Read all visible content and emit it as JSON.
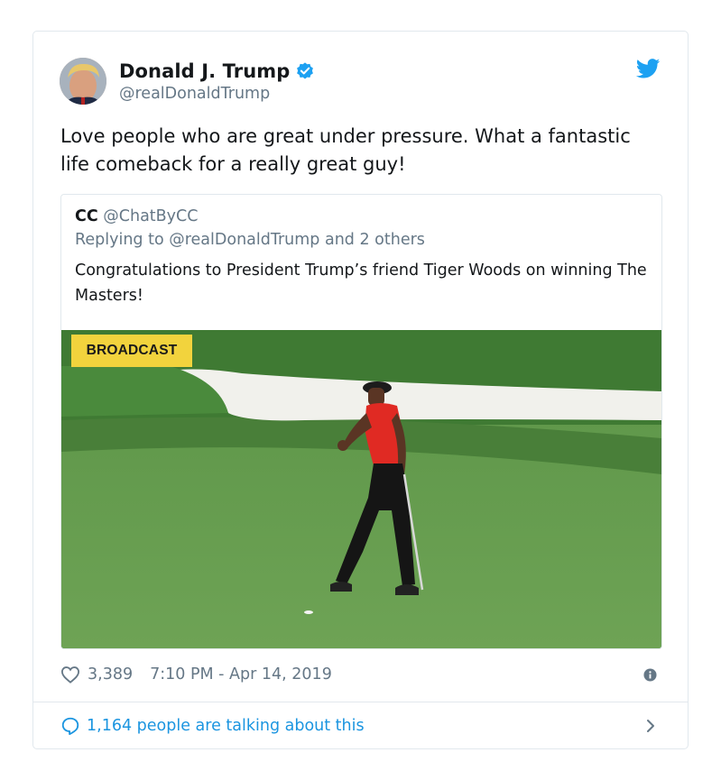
{
  "tweet": {
    "author": {
      "display_name": "Donald J. Trump",
      "handle": "@realDonaldTrump",
      "verified": true,
      "avatar_icon": "profile-photo"
    },
    "text": "Love people who are great under pressure. What a fantastic life comeback for a really great guy!",
    "brand_icon": "twitter-bird-icon",
    "brand_color": "#1da1f2",
    "likes": "3,389",
    "timestamp": "7:10 PM - Apr 14, 2019",
    "conversation_label": "1,164 people are talking about this"
  },
  "quoted_tweet": {
    "display_name": "CC",
    "handle": "@ChatByCC",
    "replying_to": "Replying to @realDonaldTrump and 2 others",
    "text": "Congratulations to President Trump’s friend Tiger Woods on winning The Masters!",
    "media_badge": "BROADCAST",
    "badge_color": "#f2d33d"
  },
  "colors": {
    "text_primary": "#14171a",
    "text_secondary": "#657786",
    "link": "#1b95e0",
    "border": "#e1e8ed"
  }
}
